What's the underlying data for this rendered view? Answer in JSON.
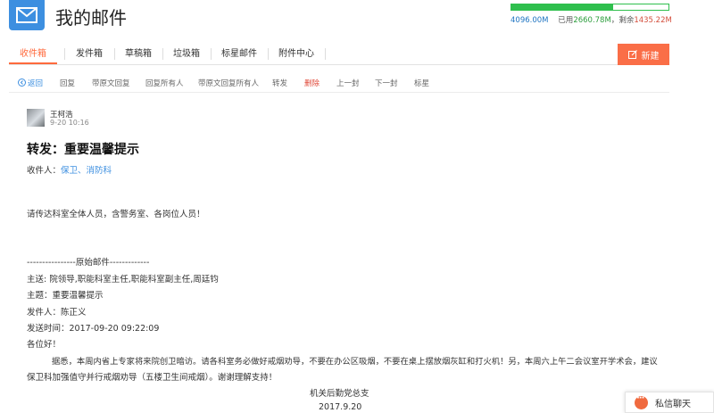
{
  "app": {
    "title": "我的邮件"
  },
  "quota": {
    "total": "4096.00M",
    "used_label": "已用",
    "used_value": "2660.78M",
    "sep": "，",
    "left_label": "剩余",
    "left_value": "1435.22M",
    "used_fraction": 0.65
  },
  "tabs": [
    {
      "label": "收件箱",
      "active": true
    },
    {
      "label": "发件箱"
    },
    {
      "label": "草稿箱"
    },
    {
      "label": "垃圾箱"
    },
    {
      "label": "标星邮件"
    },
    {
      "label": "附件中心"
    }
  ],
  "new_button": {
    "label": "新建"
  },
  "toolbar": {
    "back": "返回",
    "reply": "回复",
    "reply_with_orig": "带原文回复",
    "reply_all": "回复所有人",
    "reply_all_with_orig": "带原文回复所有人",
    "forward": "转发",
    "delete": "删除",
    "prev": "上一封",
    "next": "下一封",
    "star": "标星"
  },
  "message": {
    "sender": "王柯浩",
    "time": "9-20 10:16",
    "subject": "转发：重要温馨提示",
    "recipients_label": "收件人：",
    "recipients": "保卫、消防科",
    "body": [
      "请传达科室全体人员，含警务室、各岗位人员！",
      "----------------原始邮件-------------",
      "主送: 院领导,职能科室主任,职能科室副主任,周廷钧",
      "主题：重要温馨提示",
      "发件人：陈正义",
      "发送时间：2017-09-20 09:22:09",
      "各位好！",
      "据悉，本周内省上专家将来院创卫暗访。请各科室务必做好戒烟劝导，不要在办公区吸烟，不要在桌上摆放烟灰缸和打火机！另，本周六上午二会议室开学术会，建议",
      "保卫科加强值守并行戒烟劝导（五楼卫生间戒烟）。谢谢理解支持！",
      "机关后勤党总支",
      "2017.9.20"
    ]
  },
  "chat": {
    "label": "私信聊天"
  }
}
